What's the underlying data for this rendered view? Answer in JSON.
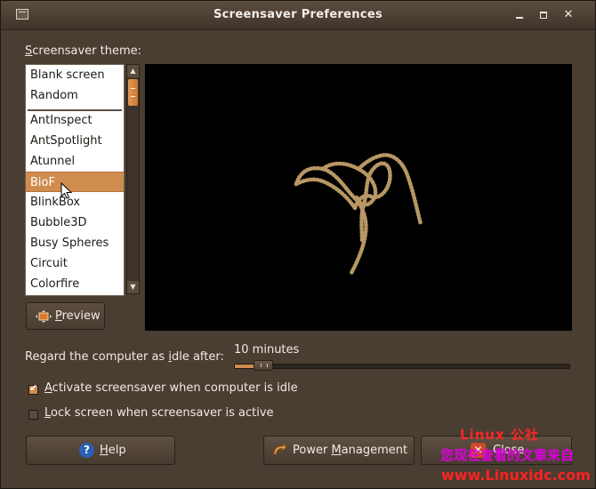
{
  "window": {
    "title": "Screensaver Preferences",
    "minimize_icon": "minimize-icon",
    "maximize_icon": "maximize-icon",
    "close_icon": "close-icon"
  },
  "themes": {
    "label_prefix": "S",
    "label_rest": "creensaver theme:",
    "items": [
      {
        "label": "Blank screen"
      },
      {
        "label": "Random"
      },
      {
        "label": "AntInspect"
      },
      {
        "label": "AntSpotlight"
      },
      {
        "label": "Atunnel"
      },
      {
        "label": "BioF",
        "selected": true
      },
      {
        "label": "BlinkBox"
      },
      {
        "label": "Bubble3D"
      },
      {
        "label": "Busy Spheres"
      },
      {
        "label": "Circuit"
      },
      {
        "label": "Colorfire"
      }
    ]
  },
  "preview_button": {
    "accel": "P",
    "rest": "review"
  },
  "idle": {
    "label_before": "Regard the computer as ",
    "label_accel": "i",
    "label_after": "dle after:",
    "value": "10 minutes",
    "slider_fraction": 0.075
  },
  "options": {
    "activate_accel": "A",
    "activate_rest": "ctivate screensaver when computer is idle",
    "activate_checked": true,
    "lock_accel": "L",
    "lock_rest": "ock screen when screensaver is active",
    "lock_checked": false
  },
  "buttons": {
    "help_accel": "H",
    "help_rest": "elp",
    "power_before": "Power ",
    "power_accel": "M",
    "power_after": "anagement",
    "close_label": "Close"
  },
  "watermark": {
    "line1": "Linux 公社",
    "line2": "您现在查看的文章来自",
    "line3": "www.Linuxidc.com"
  },
  "colors": {
    "accent": "#d08c4f",
    "window_bg": "#4a3d31",
    "help_blue": "#2c5fb7",
    "close_red": "#d04a2b"
  }
}
